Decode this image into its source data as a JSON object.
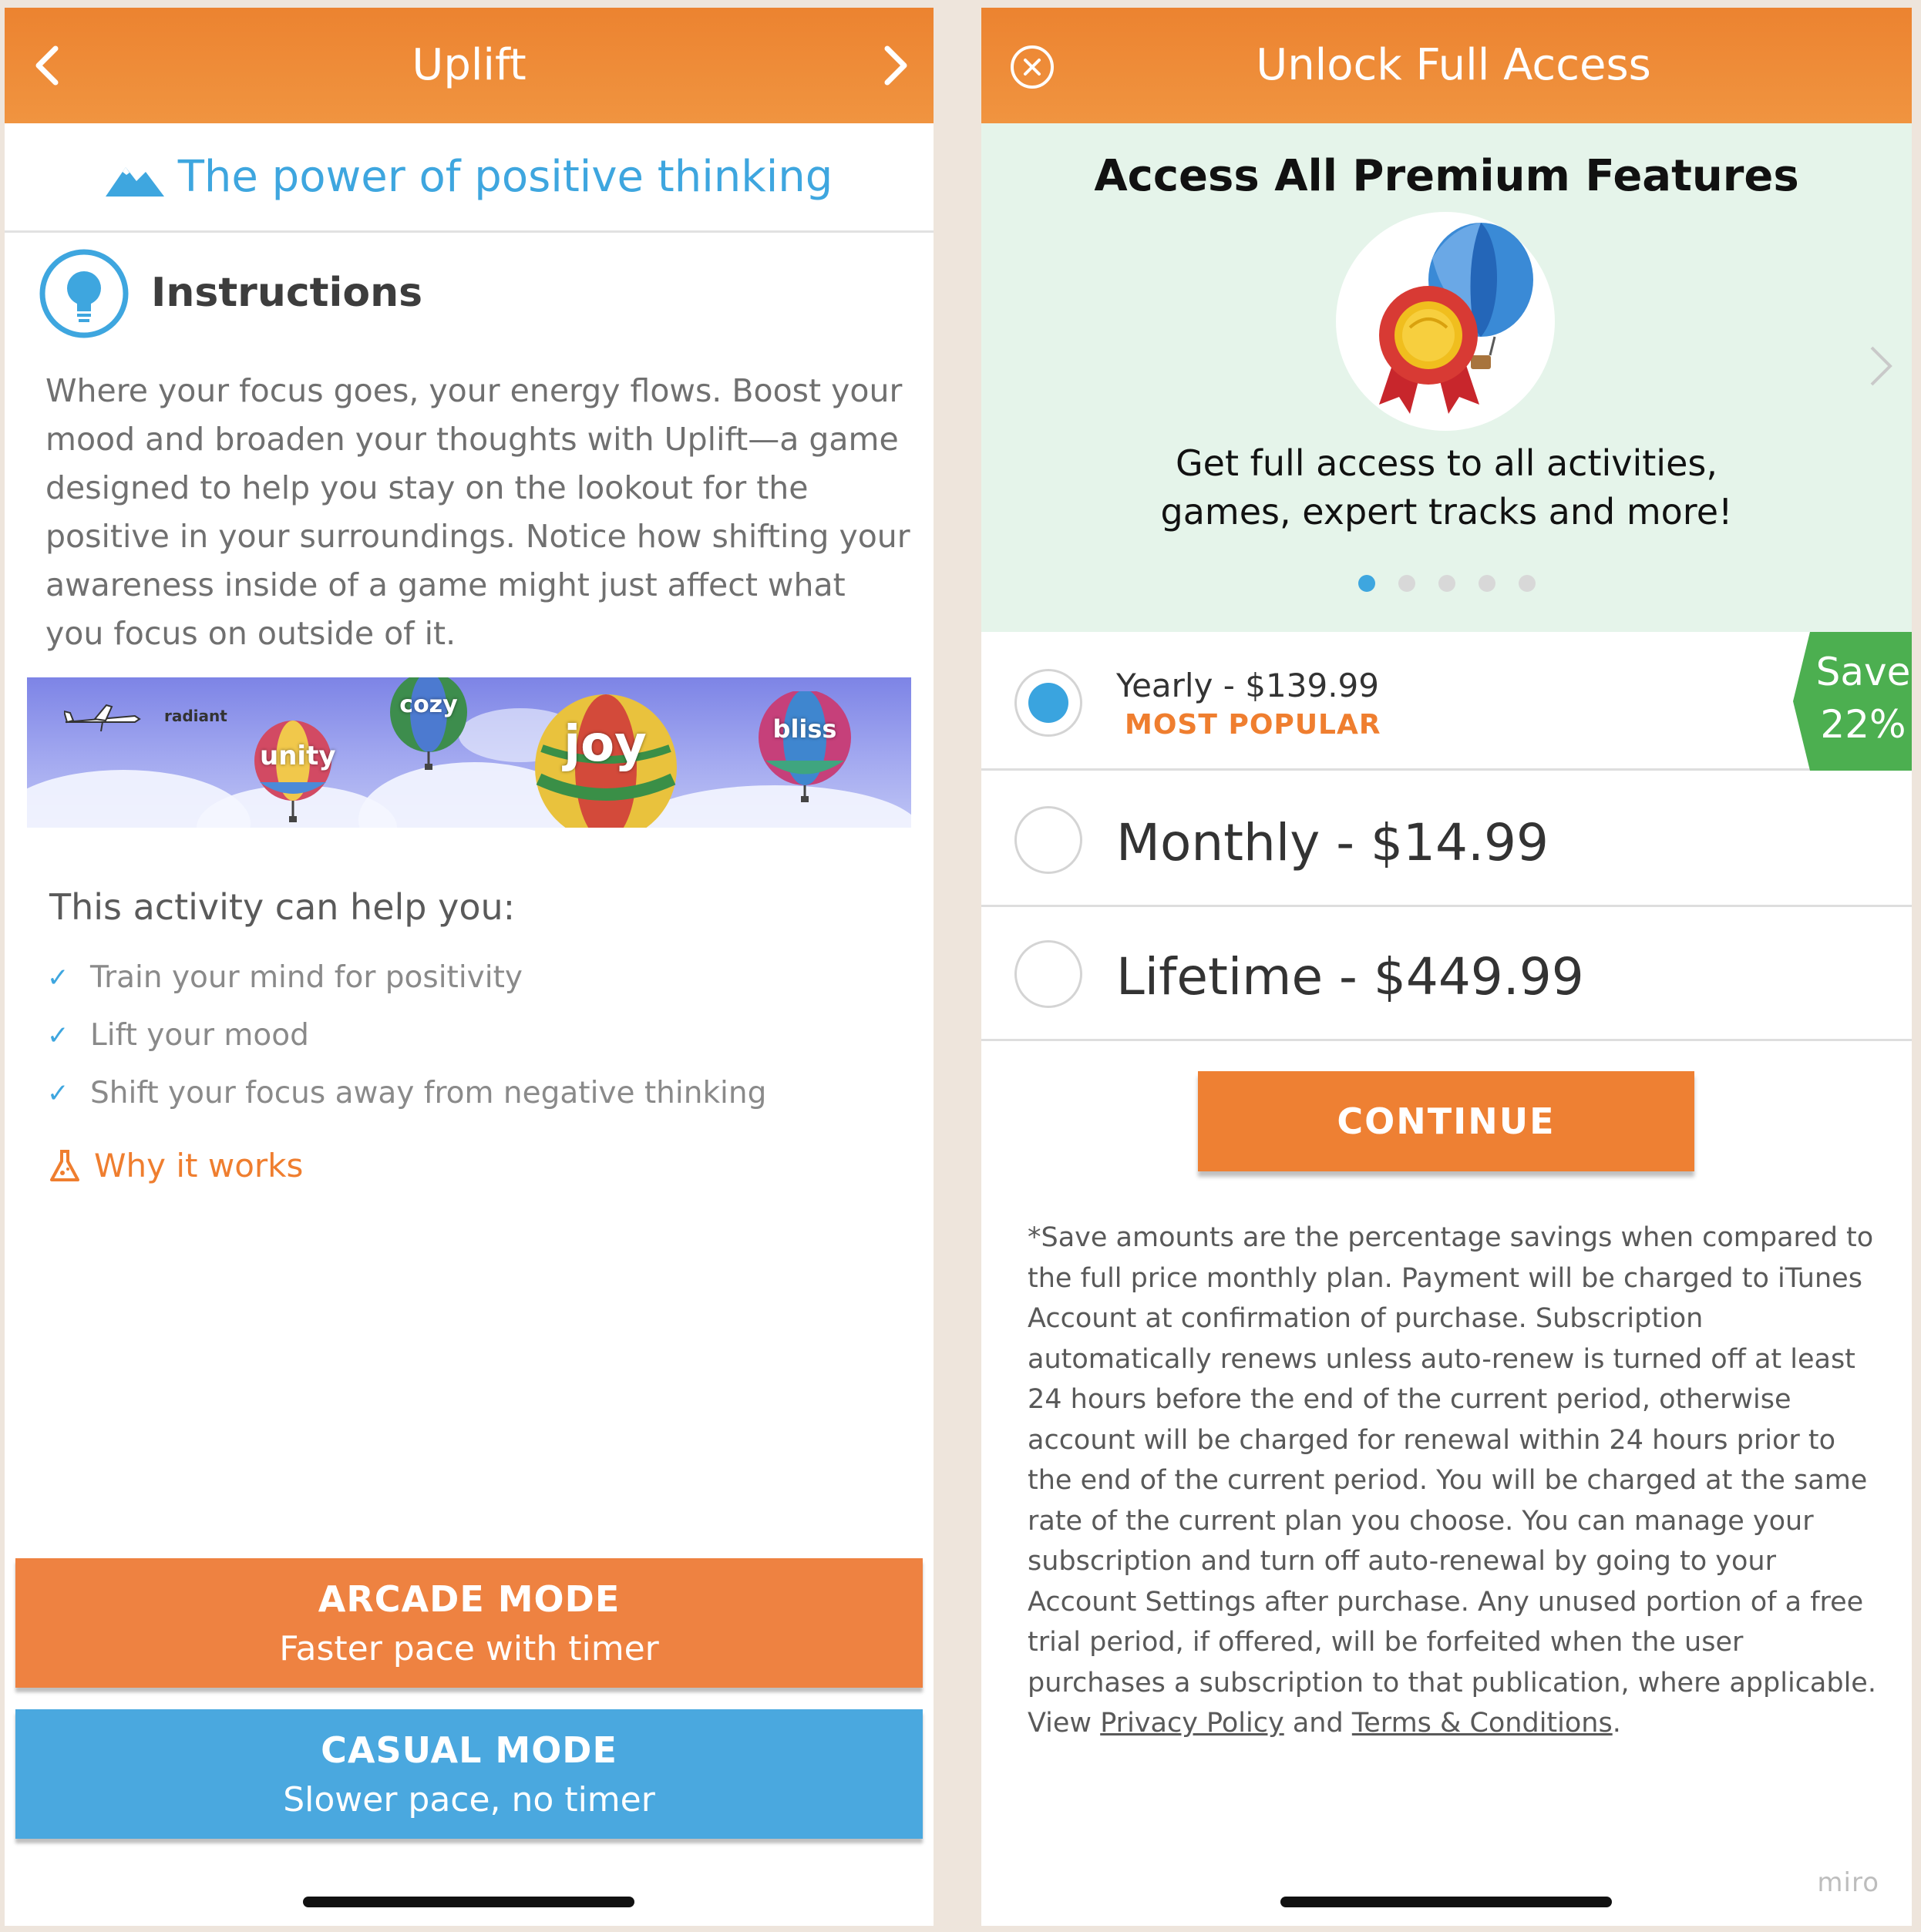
{
  "left": {
    "nav": {
      "title": "Uplift"
    },
    "subtitle": "The power of positive thinking",
    "instructions": {
      "title": "Instructions",
      "body": "Where your focus goes, your energy flows. Boost your mood and broaden your thoughts with Uplift—a game designed to help you stay on the lookout for the positive in your surroundings. Notice how shifting your awareness inside of a game might just affect what you focus on outside of it."
    },
    "banner_words": [
      "radiant",
      "unity",
      "cozy",
      "joy",
      "bliss"
    ],
    "help": {
      "title": "This activity can help you:",
      "items": [
        "Train your mind for positivity",
        "Lift your mood",
        "Shift your focus away from negative thinking"
      ]
    },
    "why_link": "Why it works",
    "arcade": {
      "title": "ARCADE MODE",
      "subtitle": "Faster pace with timer"
    },
    "casual": {
      "title": "CASUAL MODE",
      "subtitle": "Slower pace, no timer"
    }
  },
  "right": {
    "nav": {
      "title": "Unlock Full Access"
    },
    "promo": {
      "title": "Access All Premium Features",
      "desc_line1": "Get full access to all activities,",
      "desc_line2": "games, expert tracks and more!",
      "dots_total": 5,
      "dots_active": 1
    },
    "plans": {
      "yearly": {
        "label": "Yearly - $139.99",
        "badge": "MOST POPULAR",
        "save_line1": "Save",
        "save_line2": "22%",
        "selected": true
      },
      "monthly": {
        "label": "Monthly - $14.99",
        "selected": false
      },
      "lifetime": {
        "label": "Lifetime - $449.99",
        "selected": false
      }
    },
    "continue_label": "CONTINUE",
    "legal": {
      "text": "*Save amounts are the percentage savings when compared to the full price monthly plan. Payment will be charged to iTunes Account at confirmation of purchase. Subscription automatically renews unless auto-renew is turned off at least 24 hours before the end of the current period, otherwise account will be charged for renewal within 24 hours prior to the end of the current period. You will be charged at the same rate of the current plan you choose. You can manage your subscription and turn off auto-renewal by going to your Account Settings after purchase. Any unused portion of a free trial period, if offered, will be forfeited when the user purchases a subscription to that publication, where applicable. View ",
      "privacy_link": "Privacy Policy",
      "and": " and ",
      "terms_link": "Terms & Conditions",
      "end": "."
    },
    "watermark": "miro"
  },
  "colors": {
    "header_orange": "#ec8330",
    "accent_blue": "#3ea6df",
    "accent_orange": "#ef7e2f",
    "save_green": "#4caf50",
    "promo_bg": "#e5f4ea"
  }
}
